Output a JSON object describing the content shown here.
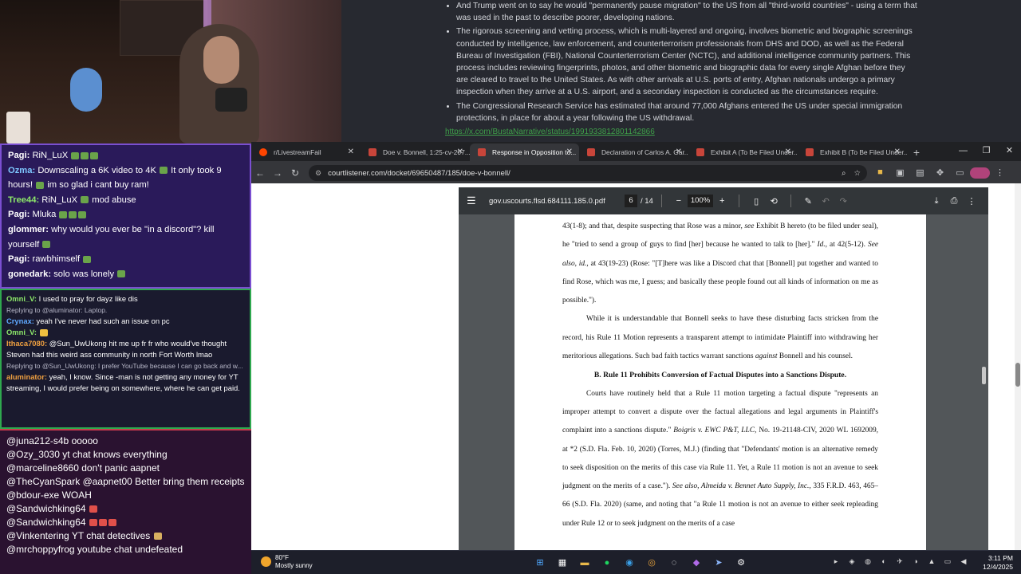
{
  "article": {
    "bullets": [
      "And Trump went on to say he would \"permanently pause migration\" to the US from all \"third-world countries\" - using a term that was used in the past to describe poorer, developing nations.",
      "The rigorous screening and vetting process, which is multi-layered and ongoing, involves biometric and biographic screenings conducted by intelligence, law enforcement, and counterterrorism professionals from DHS and DOD, as well as the Federal Bureau of Investigation (FBI), National Counterterrorism Center (NCTC), and additional intelligence community partners. This process includes reviewing fingerprints, photos, and other biometric and biographic data for every single Afghan before they are cleared to travel to the United States. As with other arrivals at U.S. ports of entry, Afghan nationals undergo a primary inspection when they arrive at a U.S. airport, and a secondary inspection is conducted as the circumstances require.",
      "The Congressional Research Service has estimated that around 77,000 Afghans entered the US under special immigration protections, in place for about a year following the US withdrawal."
    ],
    "link": "https://x.com/BustaNarrative/status/1991933812801142866"
  },
  "twitch_chat": [
    {
      "user": "Pagi:",
      "user_color": "#ffffff",
      "text": "RiN_LuX",
      "emotes": 3
    },
    {
      "user": "Ozma:",
      "user_color": "#7ec8ff",
      "text": "Downscaling a 6K video to 4K",
      "emotes": 1,
      "text2": "It only took 9 hours!",
      "emotes2": 1,
      "text3": "im so glad i cant buy ram!"
    },
    {
      "user": "Tree44:",
      "user_color": "#8de86a",
      "text": "RiN_LuX",
      "emotes": 1,
      "text2": "mod abuse"
    },
    {
      "user": "Pagi:",
      "user_color": "#ffffff",
      "text": "Mluka",
      "emotes": 3
    },
    {
      "user": "glommer:",
      "user_color": "#ffffff",
      "text": "why would you ever be \"in a discord\"? kill yourself",
      "emotes": 1
    },
    {
      "user": "Pagi:",
      "user_color": "#ffffff",
      "text": "rawbhimself",
      "emotes": 1
    },
    {
      "user": "gonedark:",
      "user_color": "#ffffff",
      "text": "solo was lonely",
      "emotes": 1
    }
  ],
  "kick_chat": [
    {
      "reply": "",
      "user": "Omni_V:",
      "user_color": "#8de86a",
      "text": "I used to pray for dayz like dis"
    },
    {
      "reply": "Replying to @aluminator: Laptop.",
      "user": "Crynax:",
      "user_color": "#5fa8ff",
      "text": "yeah I've never had such an issue on pc"
    },
    {
      "reply": "",
      "user": "Omni_V:",
      "user_color": "#8de86a",
      "text": ""
    },
    {
      "reply": "",
      "user": "Ithaca7080:",
      "user_color": "#f0a040",
      "text": "@Sun_UwUkong hit me up fr fr who would've thought Steven had this weird ass community in north Fort Worth lmao"
    },
    {
      "reply": "Replying to @Sun_UwUkong: I prefer YouTube because I can go back and w...",
      "user": "aluminator:",
      "user_color": "#f0a040",
      "text": "yeah, I know. Since -man is not getting any money for YT streaming, I would prefer being on somewhere, where he can get paid."
    }
  ],
  "yt_chat": [
    {
      "user": "@juna212-s4b",
      "text": "ooooo"
    },
    {
      "user": "@Ozy_3030",
      "text": "yt chat knows everything"
    },
    {
      "user": "@marceline8660",
      "text": "don't panic aapnet"
    },
    {
      "user": "@TheCyanSpark",
      "text": "@aapnet00 Better bring them receipts"
    },
    {
      "user": "@bdour-exe",
      "text": "WOAH"
    },
    {
      "user": "@Sandwichking64",
      "text": ""
    },
    {
      "user": "@Sandwichking64",
      "text": ""
    },
    {
      "user": "@Vinkentering",
      "text": "YT chat detectives"
    },
    {
      "user": "@mrchoppyfrog",
      "text": "youtube chat undefeated"
    }
  ],
  "browser": {
    "tabs": [
      {
        "label": "r/LivestreamFail",
        "active": false,
        "fav": "reddit"
      },
      {
        "label": "Doe v. Bonnell, 1:25-cv-207...",
        "active": false,
        "fav": "cl"
      },
      {
        "label": "Response in Opposition to...",
        "active": true,
        "fav": "cl"
      },
      {
        "label": "Declaration of Carlos A. Gar...",
        "active": false,
        "fav": "cl"
      },
      {
        "label": "Exhibit A (To Be Filed Under...",
        "active": false,
        "fav": "cl"
      },
      {
        "label": "Exhibit B (To Be Filed Under...",
        "active": false,
        "fav": "cl"
      }
    ],
    "url": "courtlistener.com/docket/69650487/185/doe-v-bonnell/"
  },
  "pdf": {
    "filename": "gov.uscourts.flsd.684111.185.0.pdf",
    "page": "6",
    "total_pages": "/ 14",
    "zoom": "100%",
    "text": {
      "p1a": "43(1-8); and that, despite suspecting that Rose was a minor,",
      "p1b": "see",
      "p1c": "Exhibit B hereto (to be filed under seal), he \"tried to send a group of guys to find [her] because he wanted to talk to [her].\"",
      "p1d": "Id.",
      "p1e": ", at 42(5-12).",
      "p1f": "See also, id.",
      "p1g": ", at 43(19-23) (Rose: \"[T]here was like a Discord chat that [Bonnell] put together and wanted to find Rose, which was me, I guess; and basically these people found out all kinds of information on me as possible.\").",
      "p2a": "While it is understandable that Bonnell seeks to have these disturbing facts stricken from the record, his Rule 11 Motion represents a transparent attempt to intimidate Plaintiff into withdrawing her meritorious allegations. Such bad faith tactics warrant sanctions",
      "p2b": "against",
      "p2c": "Bonnell and his counsel.",
      "heading": "B.  Rule 11 Prohibits Conversion of Factual Disputes into a Sanctions Dispute.",
      "p3a": "Courts have routinely held that a Rule 11 motion targeting a factual dispute \"represents an improper attempt to convert a dispute over the factual allegations and legal arguments in Plaintiff's complaint into a sanctions dispute.\"",
      "p3b": "Boigris v. EWC P&T, LLC",
      "p3c": ", No. 19-21148-CIV, 2020 WL 1692009, at *2 (S.D. Fla. Feb. 10, 2020) (Torres, M.J.) (finding that \"Defendants' motion is an alternative remedy to seek disposition on the merits of this case via Rule 11. Yet, a Rule 11 motion is not an avenue to seek judgment on the merits of a case.\").",
      "p3d": "See also, Almeida v. Bennet Auto Supply, Inc.",
      "p3e": ", 335 F.R.D. 463, 465–66 (S.D. Fla. 2020) (same, and noting that \"a Rule 11 motion is not an avenue to either seek repleading under Rule 12 or to seek judgment on the merits of a case"
    }
  },
  "taskbar": {
    "temp": "80°F",
    "weather": "Mostly sunny",
    "time": "3:11 PM",
    "date": "12/4/2025"
  }
}
